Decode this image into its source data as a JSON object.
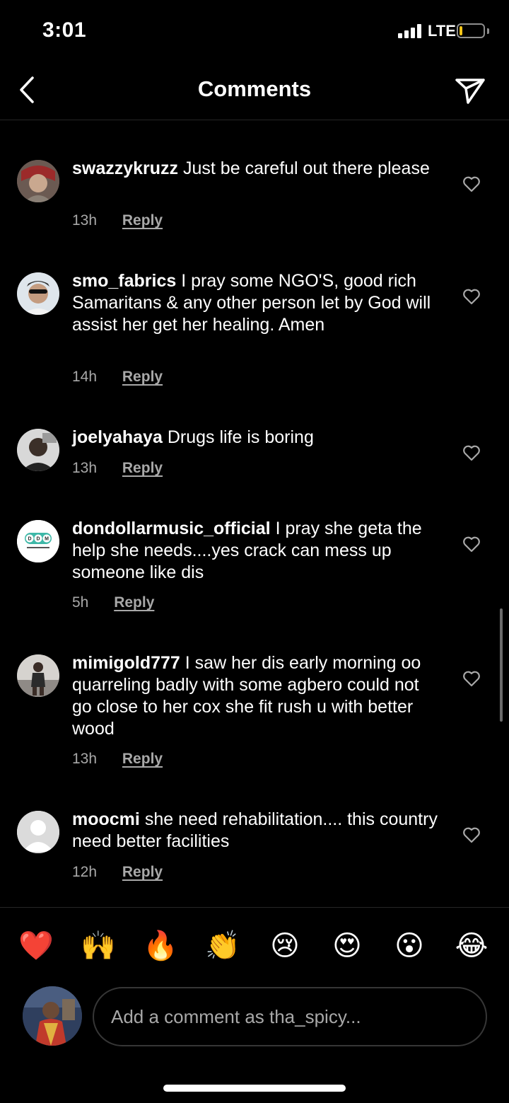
{
  "status_bar": {
    "time": "3:01",
    "network": "LTE"
  },
  "header": {
    "title": "Comments",
    "back_icon": "chevron-left-icon",
    "share_icon": "paper-plane-icon"
  },
  "comments": [
    {
      "username": "swazzykruzz",
      "text": "Just be careful out there please",
      "time": "13h",
      "reply": "Reply"
    },
    {
      "username": "smo_fabrics",
      "text": "I pray some NGO'S, good rich Samaritans & any other person let by God will assist her get her healing. Amen",
      "time": "14h",
      "reply": "Reply"
    },
    {
      "username": "joelyahaya",
      "text": "Drugs life is boring",
      "time": "13h",
      "reply": "Reply"
    },
    {
      "username": "dondollarmusic_official",
      "text": "I pray she geta the help she needs....yes crack can mess up someone like dis",
      "time": "5h",
      "reply": "Reply"
    },
    {
      "username": "mimigold777",
      "text": "I saw her dis early morning oo quarreling badly with some agbero could not go close to her cox she fit rush u with better wood",
      "time": "13h",
      "reply": "Reply"
    },
    {
      "username": "moocmi",
      "text": "she need rehabilitation.... this country need better facilities",
      "time": "12h",
      "reply": "Reply"
    }
  ],
  "avatar_logo": {
    "letters": "DDM",
    "caption": "DON DOLLAR MUSIC"
  },
  "reactions": [
    "❤️",
    "🙌",
    "🔥",
    "👏",
    "😢",
    "😍",
    "😮",
    "😂"
  ],
  "composer": {
    "placeholder": "Add a comment as tha_spicy..."
  },
  "colors": {
    "background": "#000000",
    "secondary_text": "#a8a8a8",
    "battery": "#f5c518"
  }
}
